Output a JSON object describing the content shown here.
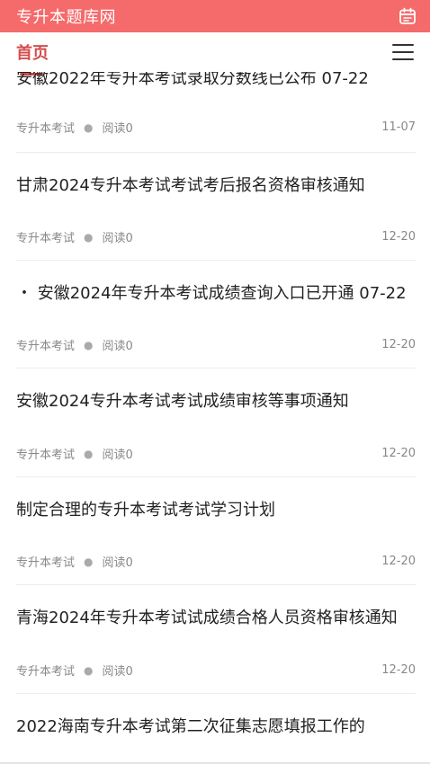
{
  "header": {
    "site_title": "专升本题库网",
    "calendar_icon": "calendar-icon"
  },
  "nav": {
    "home_label": "首页",
    "menu_icon": "hamburger-menu-icon"
  },
  "articles": [
    {
      "title": "安徽2022年专升本考试录取分数线已公布 07-22",
      "category": "专升本考试",
      "reads": "阅读0",
      "date": "11-07"
    },
    {
      "title": "甘肃2024专升本考试考试考后报名资格审核通知",
      "category": "专升本考试",
      "reads": "阅读0",
      "date": "12-20"
    },
    {
      "title": "・ 安徽2024年专升本考试成绩查询入口已开通 07-22",
      "category": "专升本考试",
      "reads": "阅读0",
      "date": "12-20"
    },
    {
      "title": "安徽2024专升本考试考试成绩审核等事项通知",
      "category": "专升本考试",
      "reads": "阅读0",
      "date": "12-20"
    },
    {
      "title": "制定合理的专升本考试考试学习计划",
      "category": "专升本考试",
      "reads": "阅读0",
      "date": "12-20"
    },
    {
      "title": "青海2024年专升本考试试成绩合格人员资格审核通知",
      "category": "专升本考试",
      "reads": "阅读0",
      "date": "12-20"
    },
    {
      "title": "2022海南专升本考试第二次征集志愿填报工作的",
      "category": "",
      "reads": "",
      "date": ""
    }
  ]
}
